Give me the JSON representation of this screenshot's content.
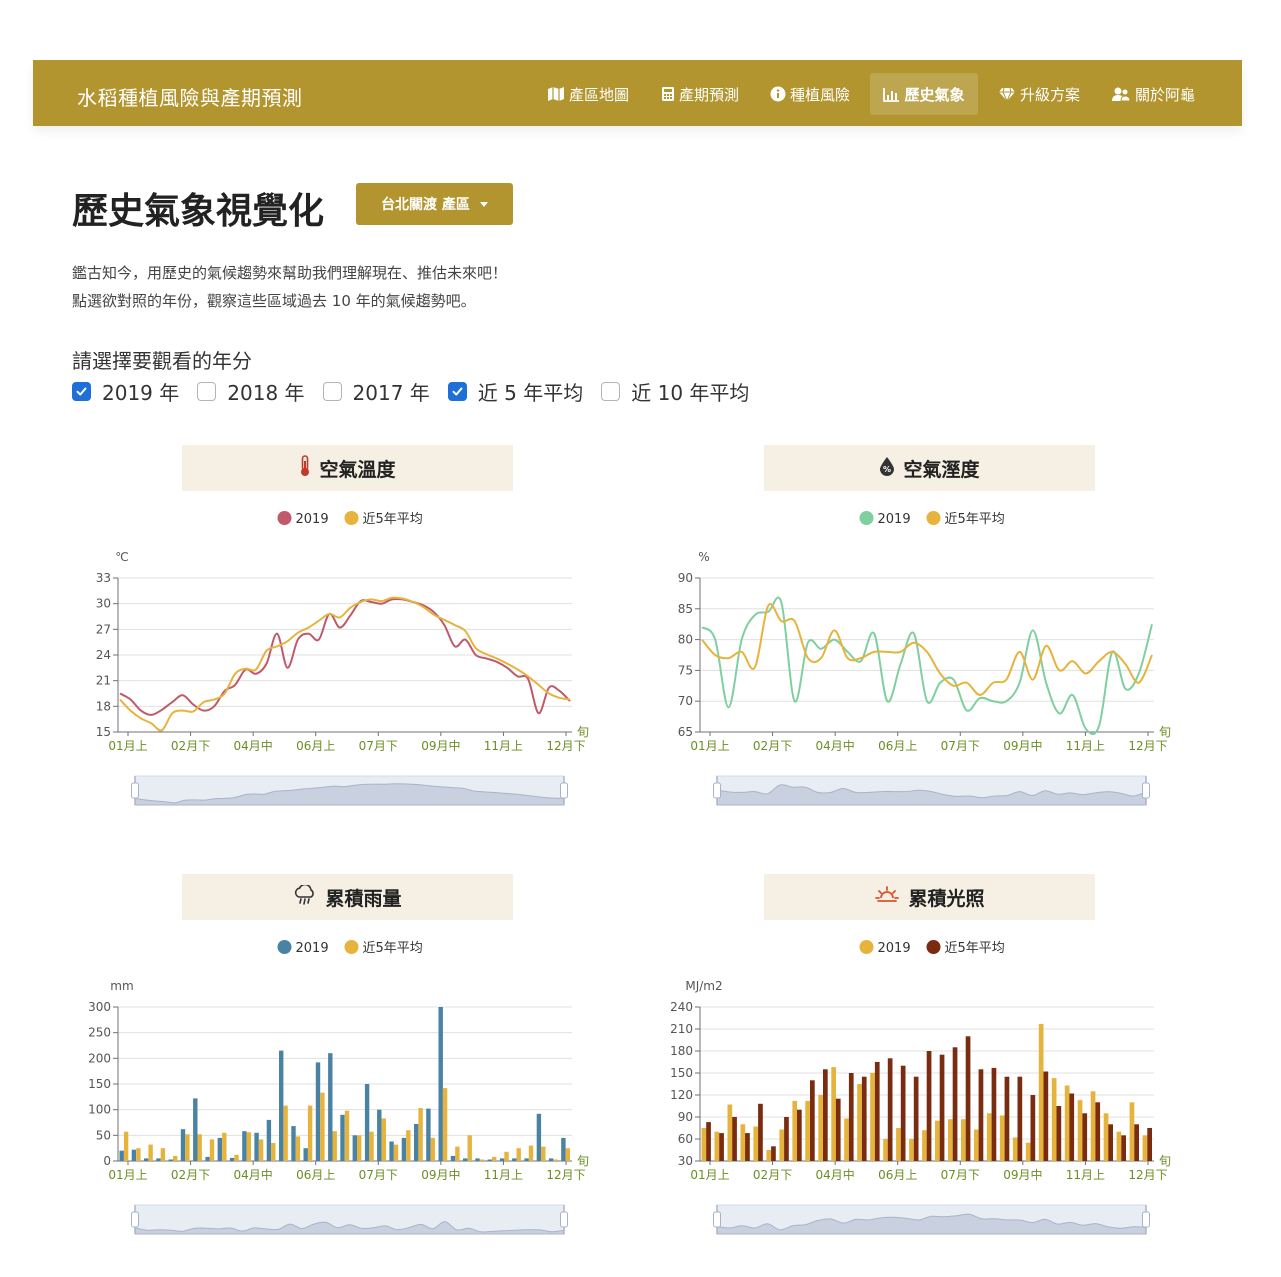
{
  "nav": {
    "brand": "水稻種植風險與產期預測",
    "items": [
      {
        "label": "產區地圖",
        "icon": "map-icon"
      },
      {
        "label": "產期預測",
        "icon": "calculator-icon"
      },
      {
        "label": "種植風險",
        "icon": "info-circle-icon"
      },
      {
        "label": "歷史氣象",
        "icon": "chart-icon"
      },
      {
        "label": "升級方案",
        "icon": "gem-icon"
      },
      {
        "label": "關於阿龜",
        "icon": "users-icon"
      }
    ],
    "active_index": 3,
    "color": "#b2952f"
  },
  "page": {
    "title": "歷史氣象視覺化",
    "region_button": "台北關渡 產區",
    "intro_line1": "鑑古知今，用歷史的氣候趨勢來幫助我們理解現在、推估未來吧！",
    "intro_line2": "點選欲對照的年份，觀察這些區域過去 10 年的氣候趨勢吧。"
  },
  "year_select": {
    "label": "請選擇要觀看的年分",
    "options": [
      {
        "label": "2019 年",
        "checked": true
      },
      {
        "label": "2018 年",
        "checked": false
      },
      {
        "label": "2017 年",
        "checked": false
      },
      {
        "label": "近 5 年平均",
        "checked": true
      },
      {
        "label": "近 10 年平均",
        "checked": false
      }
    ]
  },
  "chart_data": [
    {
      "type": "line",
      "title": "空氣溫度",
      "icon": "thermometer-icon",
      "ylabel": "℃",
      "xlabel": "旬",
      "ylim": [
        15,
        33
      ],
      "yticks": [
        15,
        18,
        21,
        24,
        27,
        30,
        33
      ],
      "x_tick_labels": [
        "01月上",
        "02月下",
        "04月中",
        "06月上",
        "07月下",
        "09月中",
        "11月上",
        "12月下"
      ],
      "grid": true,
      "legend_position": "top",
      "series": [
        {
          "name": "2019",
          "color": "#c05a6a",
          "values": [
            19.5,
            18.8,
            17.5,
            17.0,
            17.6,
            18.5,
            19.3,
            18.2,
            17.5,
            18.0,
            19.8,
            20.5,
            22.3,
            21.8,
            23.0,
            26.5,
            22.5,
            25.8,
            26.5,
            25.8,
            28.8,
            27.2,
            28.6,
            30.3,
            30.2,
            30.0,
            30.5,
            30.5,
            30.2,
            29.8,
            29.0,
            27.5,
            25.0,
            25.8,
            24.0,
            23.6,
            23.2,
            22.5,
            21.5,
            21.2,
            17.2,
            20.2,
            19.8,
            18.6
          ]
        },
        {
          "name": "近5年平均",
          "color": "#e6b43c",
          "values": [
            18.8,
            17.5,
            16.6,
            16.0,
            15.2,
            17.2,
            17.5,
            17.4,
            18.5,
            18.8,
            19.5,
            21.8,
            22.4,
            22.3,
            24.5,
            25.0,
            25.6,
            26.6,
            27.2,
            28.0,
            28.8,
            28.4,
            29.5,
            30.2,
            30.5,
            30.3,
            30.7,
            30.6,
            30.2,
            29.6,
            28.7,
            28.1,
            27.5,
            26.8,
            24.8,
            24.1,
            23.6,
            23.0,
            22.3,
            21.5,
            20.5,
            19.5,
            19.0,
            18.8
          ]
        }
      ]
    },
    {
      "type": "line",
      "title": "空氣溼度",
      "icon": "humidity-icon",
      "ylabel": "%",
      "xlabel": "旬",
      "ylim": [
        65,
        90
      ],
      "yticks": [
        65,
        70,
        75,
        80,
        85,
        90
      ],
      "x_tick_labels": [
        "01月上",
        "02月下",
        "04月中",
        "06月上",
        "07月下",
        "09月中",
        "11月上",
        "12月下"
      ],
      "grid": true,
      "legend_position": "top",
      "series": [
        {
          "name": "2019",
          "color": "#80cfa0",
          "values": [
            82.0,
            80.0,
            69.0,
            80.0,
            84.0,
            84.5,
            86.0,
            70.0,
            79.5,
            78.5,
            80.0,
            78.0,
            76.5,
            81.0,
            70.0,
            76.0,
            81.0,
            70.0,
            73.0,
            73.5,
            68.5,
            70.5,
            70.0,
            70.0,
            73.0,
            81.5,
            73.0,
            68.0,
            71.0,
            65.5,
            66.0,
            78.0,
            72.0,
            74.5,
            82.5
          ]
        },
        {
          "name": "近5年平均",
          "color": "#e6b43c",
          "values": [
            80.0,
            77.5,
            77.0,
            78.0,
            75.5,
            85.5,
            83.0,
            83.0,
            77.0,
            77.0,
            81.5,
            77.0,
            77.0,
            78.0,
            78.0,
            78.0,
            79.5,
            78.0,
            74.5,
            72.5,
            73.0,
            71.0,
            73.0,
            73.5,
            78.0,
            73.5,
            79.0,
            75.0,
            76.5,
            74.5,
            76.5,
            78.0,
            76.0,
            73.0,
            77.5
          ]
        }
      ]
    },
    {
      "type": "bar",
      "title": "累積雨量",
      "icon": "rain-cloud-icon",
      "ylabel": "mm",
      "xlabel": "旬",
      "ylim": [
        0,
        300
      ],
      "yticks": [
        0,
        50,
        100,
        150,
        200,
        250,
        300
      ],
      "x_tick_labels": [
        "01月上",
        "02月下",
        "04月中",
        "06月上",
        "07月下",
        "09月中",
        "11月上",
        "12月下"
      ],
      "grid": true,
      "legend_position": "top",
      "series": [
        {
          "name": "2019",
          "color": "#4a82a4",
          "values": [
            20,
            22,
            5,
            5,
            3,
            62,
            122,
            8,
            45,
            6,
            58,
            55,
            80,
            215,
            68,
            25,
            192,
            210,
            90,
            50,
            150,
            100,
            38,
            45,
            72,
            102,
            300,
            10,
            5,
            5,
            3,
            5,
            5,
            5,
            92,
            5,
            45
          ]
        },
        {
          "name": "近5年平均",
          "color": "#e6b43c",
          "values": [
            57,
            25,
            32,
            25,
            10,
            52,
            52,
            42,
            55,
            12,
            56,
            42,
            35,
            108,
            48,
            108,
            133,
            58,
            98,
            50,
            57,
            83,
            32,
            60,
            103,
            45,
            142,
            28,
            50,
            3,
            8,
            18,
            25,
            30,
            28,
            3,
            25
          ]
        }
      ]
    },
    {
      "type": "bar",
      "title": "累積光照",
      "icon": "sun-icon",
      "ylabel": "MJ/m2",
      "xlabel": "旬",
      "ylim": [
        30,
        240
      ],
      "yticks": [
        30,
        60,
        90,
        120,
        150,
        180,
        210,
        240
      ],
      "x_tick_labels": [
        "01月上",
        "02月下",
        "04月中",
        "06月上",
        "07月下",
        "09月中",
        "11月上",
        "12月下"
      ],
      "grid": true,
      "legend_position": "top",
      "series": [
        {
          "name": "2019",
          "color": "#e6b43c",
          "values": [
            75,
            70,
            107,
            80,
            77,
            45,
            73,
            112,
            112,
            120,
            158,
            88,
            135,
            150,
            60,
            75,
            60,
            72,
            85,
            87,
            87,
            73,
            95,
            92,
            62,
            55,
            217,
            143,
            133,
            113,
            125,
            95,
            70,
            110,
            65
          ]
        },
        {
          "name": "近5年平均",
          "color": "#7a2c10",
          "values": [
            83,
            68,
            90,
            68,
            108,
            50,
            90,
            100,
            140,
            155,
            115,
            150,
            145,
            165,
            170,
            160,
            145,
            180,
            175,
            185,
            200,
            155,
            157,
            145,
            145,
            120,
            152,
            105,
            122,
            95,
            110,
            80,
            65,
            80,
            75
          ]
        }
      ]
    }
  ]
}
